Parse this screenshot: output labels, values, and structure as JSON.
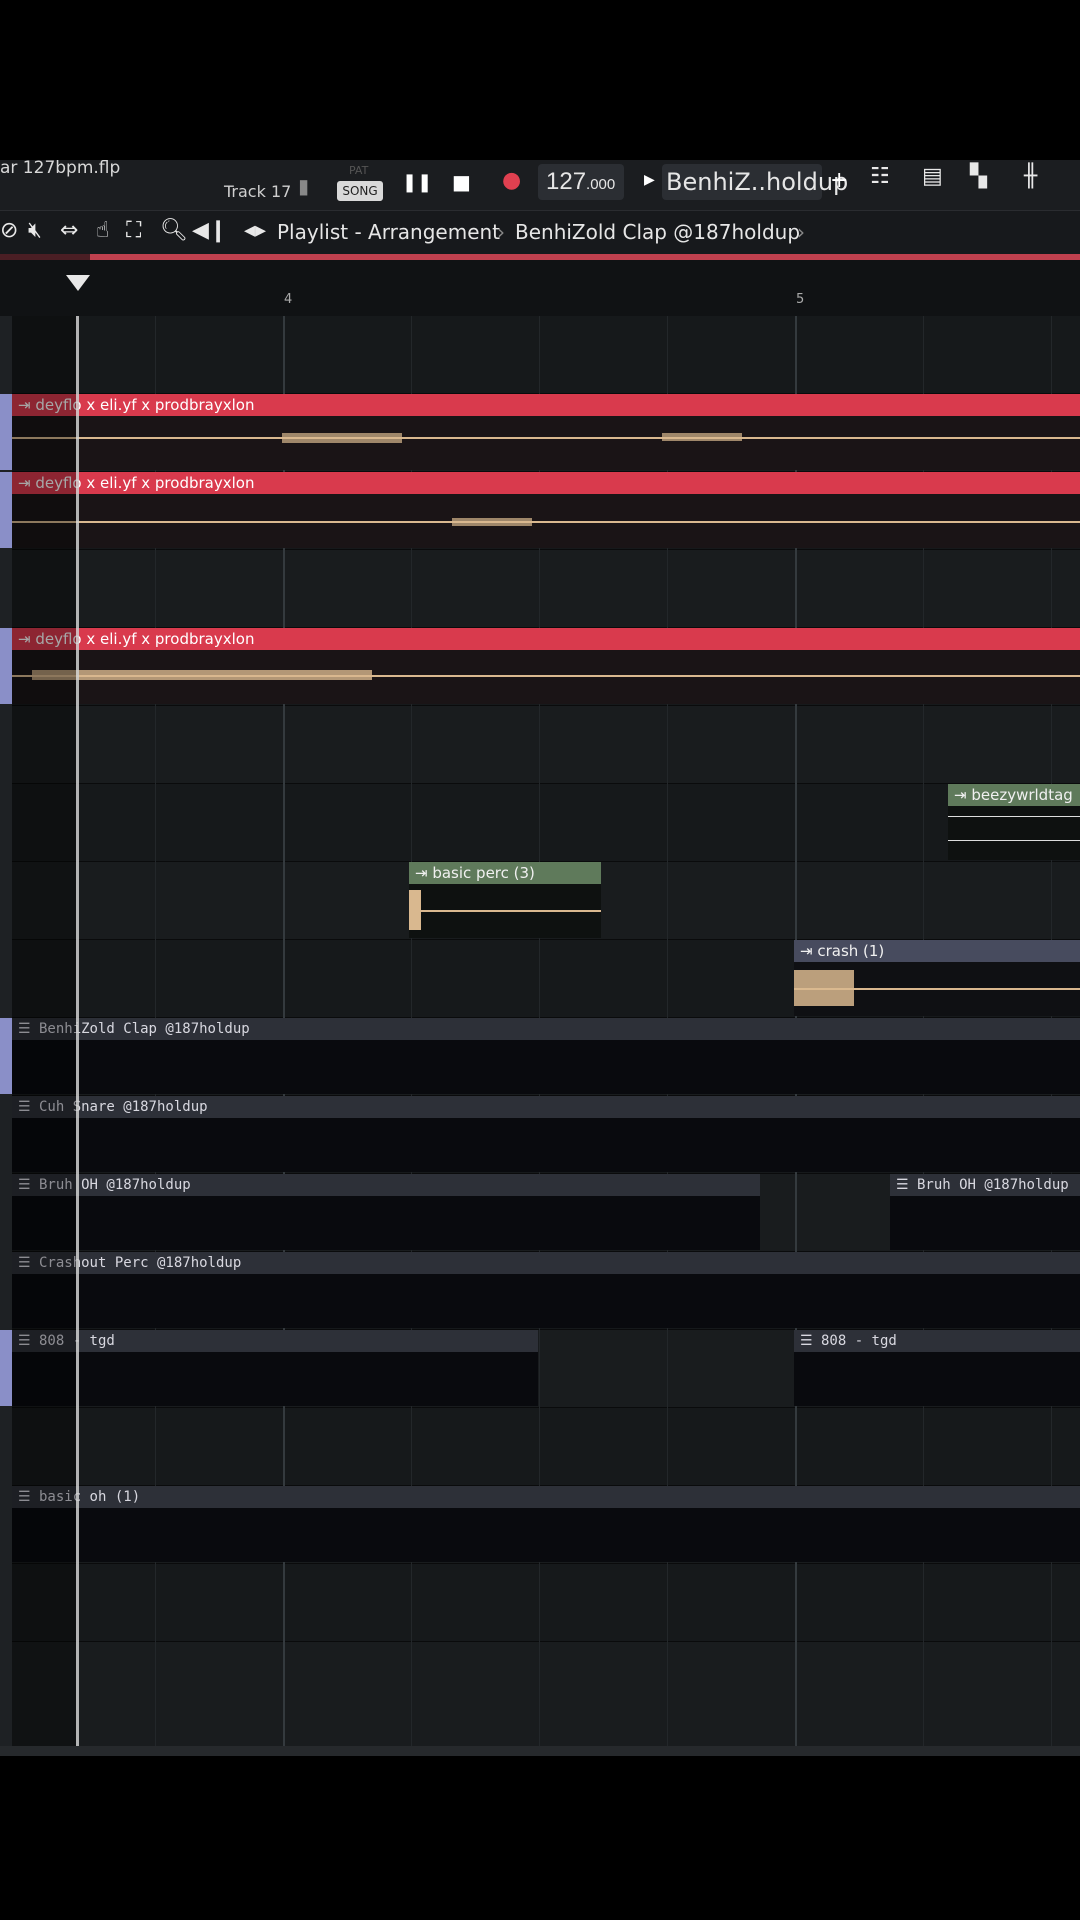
{
  "header": {
    "filename": "ar 127bpm.flp",
    "track_label": "Track 17",
    "pat_label": "PAT",
    "song_label": "SONG",
    "tempo_int": "127",
    "tempo_dec": ".000",
    "pattern_name": "BenhiZ..holdup",
    "add_label": "+"
  },
  "breadcrumb": {
    "window": "Playlist - Arrangement",
    "separator": "›",
    "item": "BenhiZold Clap @187holdup"
  },
  "timeline": {
    "bar_4": "4",
    "bar_5": "5"
  },
  "clips": {
    "audio1": "deyflo x eli.yf x prodbrayxlon",
    "audio2": "deyflo x eli.yf x prodbrayxlon",
    "audio3": "deyflo x eli.yf x prodbrayxlon",
    "beezy": "beezywrldtag",
    "perc": "basic perc (3)",
    "crash": "crash (1)",
    "clap": "BenhiZold Clap @187holdup",
    "snare": "Cuh Snare @187holdup",
    "oh1": "Bruh OH @187holdup",
    "oh2": "Bruh OH @187holdup",
    "crashout": "Crashout Perc @187holdup",
    "b808a": "808 - tgd",
    "b808b": "808 - tgd",
    "basicoh": "basic oh (1)"
  },
  "colors": {
    "audio_clip": "#d93a4d",
    "green_clip": "#5f7a5b",
    "grey_clip": "#474b5e",
    "pattern_clip": "#2d3038",
    "waveform": "#d9b88f"
  }
}
